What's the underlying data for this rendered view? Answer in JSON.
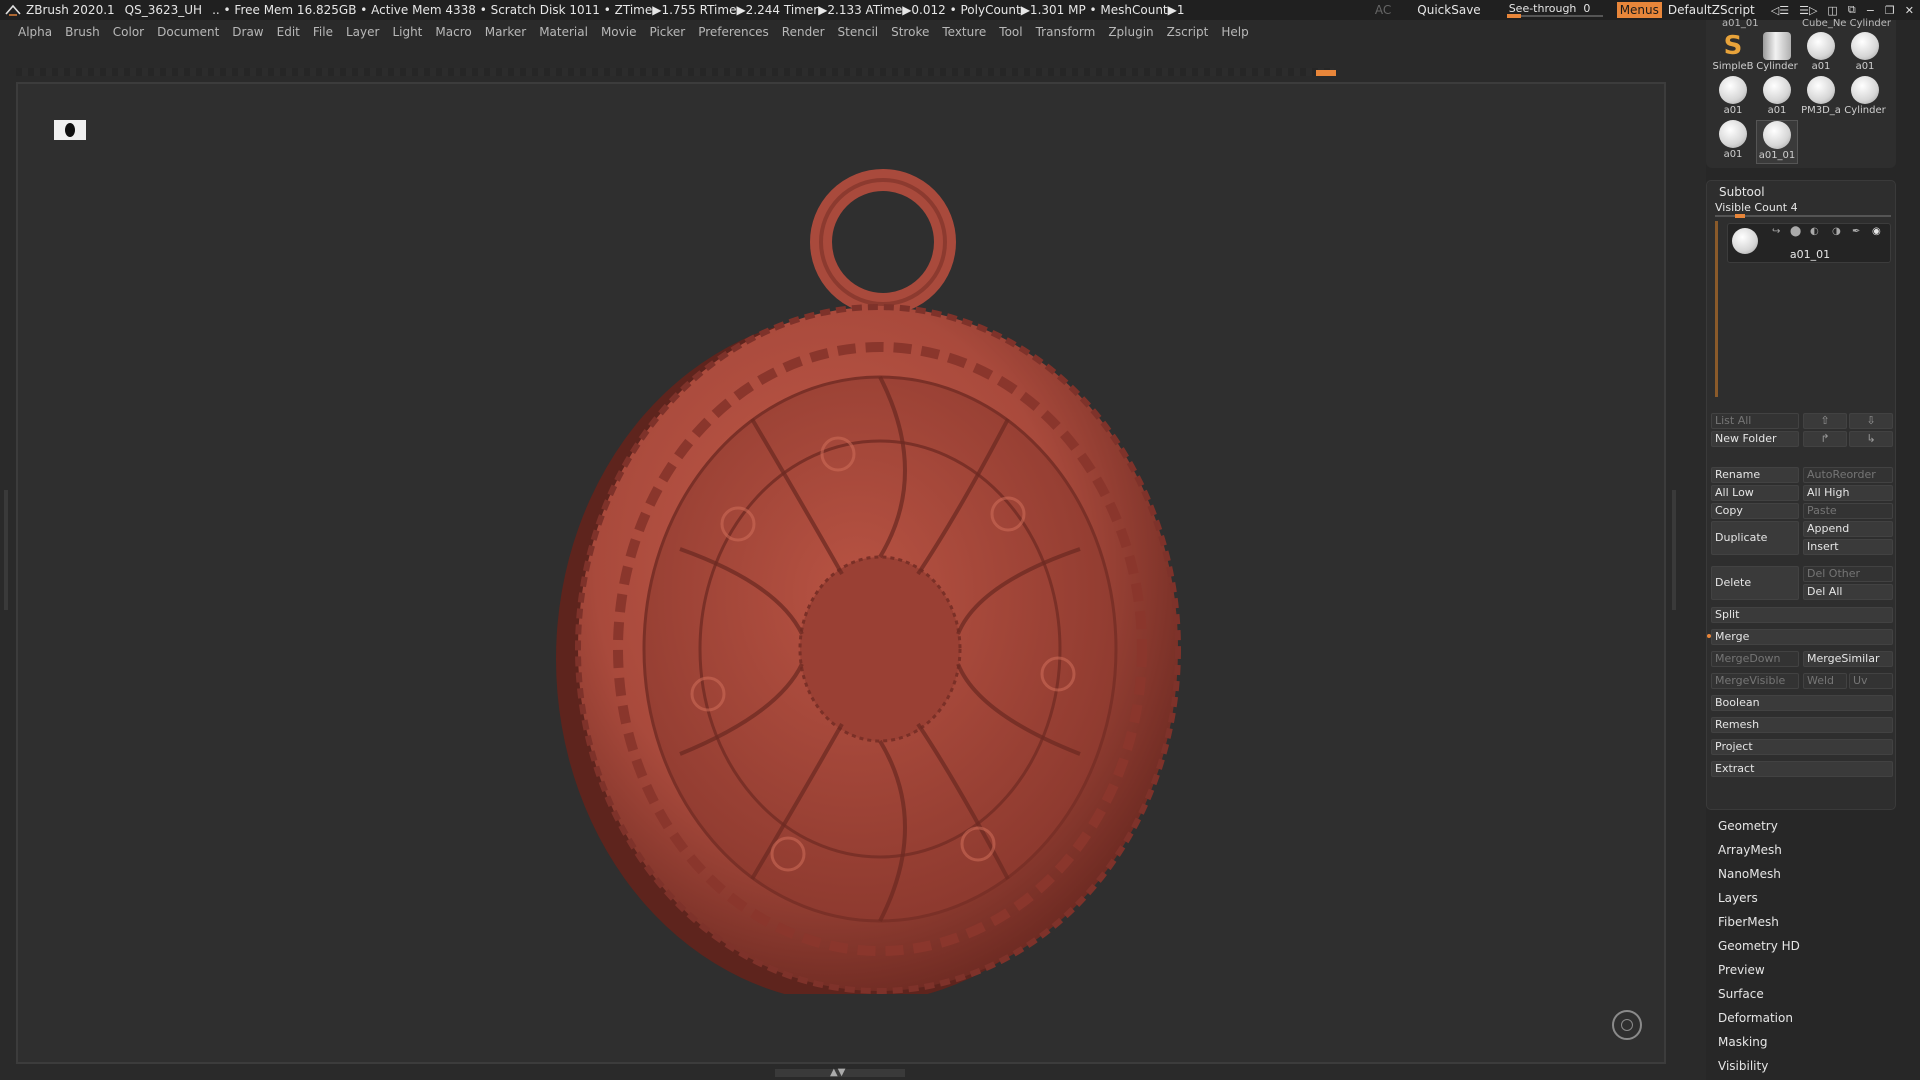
{
  "titlebar": {
    "app": "ZBrush 2020.1",
    "project": "QS_3623_UH",
    "stats": "..  • Free Mem 16.825GB • Active Mem 4338 • Scratch Disk 1011 •  ZTime▶1.755 RTime▶2.244 Timer▶2.133 ATime▶0.012 • PolyCount▶1.301 MP  • MeshCount▶1",
    "ac": "AC",
    "quicksave": "QuickSave",
    "see_through_label": "See-through",
    "see_through_value": "0",
    "menus": "Menus",
    "default_zscript": "DefaultZScript"
  },
  "menubar": [
    "Alpha",
    "Brush",
    "Color",
    "Document",
    "Draw",
    "Edit",
    "File",
    "Layer",
    "Light",
    "Macro",
    "Marker",
    "Material",
    "Movie",
    "Picker",
    "Preferences",
    "Render",
    "Stencil",
    "Stroke",
    "Texture",
    "Tool",
    "Transform",
    "Zplugin",
    "Zscript",
    "Help"
  ],
  "tool_thumbs": {
    "top_partial": [
      "a01_01",
      "Cube_Ne Cylinder"
    ],
    "items": [
      {
        "label": "SimpleB",
        "kind": "sb"
      },
      {
        "label": "Cylinder",
        "kind": "cyl"
      },
      {
        "label": "a01",
        "kind": "sphere"
      },
      {
        "label": "a01",
        "kind": "sphere"
      },
      {
        "label": "a01",
        "kind": "sphere"
      },
      {
        "label": "a01",
        "kind": "sphere"
      },
      {
        "label": "PM3D_a",
        "kind": "sphere"
      },
      {
        "label": "Cylinder",
        "kind": "sphere"
      },
      {
        "label": "a01",
        "kind": "sphere"
      },
      {
        "label": "a01_01",
        "kind": "sphere"
      }
    ]
  },
  "subtool": {
    "title": "Subtool",
    "visible_count": "Visible Count 4",
    "item_name": "a01_01",
    "list_all": "List All",
    "new_folder": "New Folder",
    "rename": "Rename",
    "auto_reorder": "AutoReorder",
    "all_low": "All Low",
    "all_high": "All High",
    "copy": "Copy",
    "paste": "Paste",
    "duplicate": "Duplicate",
    "append": "Append",
    "insert": "Insert",
    "delete": "Delete",
    "del_other": "Del Other",
    "del_all": "Del All",
    "split": "Split",
    "merge": "Merge",
    "merge_down": "MergeDown",
    "merge_similar": "MergeSimilar",
    "merge_visible": "MergeVisible",
    "weld": "Weld",
    "uv": "Uv",
    "boolean": "Boolean",
    "remesh": "Remesh",
    "project": "Project",
    "extract": "Extract"
  },
  "palettes": [
    "Geometry",
    "ArrayMesh",
    "NanoMesh",
    "Layers",
    "FiberMesh",
    "Geometry HD",
    "Preview",
    "Surface",
    "Deformation",
    "Masking",
    "Visibility"
  ],
  "colors": {
    "accent": "#e8863a",
    "model": "#a94a3c",
    "model_dark": "#6d2a22",
    "background": "#2f2f2f"
  },
  "icons": {
    "perspective": "perspective-toggle-icon",
    "nav": "navigation-gizmo-icon"
  }
}
